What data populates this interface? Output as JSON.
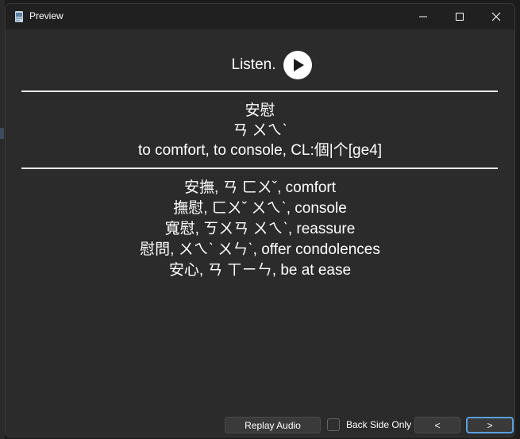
{
  "window": {
    "title": "Preview"
  },
  "listen": {
    "label": "Listen."
  },
  "front": {
    "word": "安慰",
    "zhuyin": "ㄢ ㄨㄟˋ",
    "definition": "to comfort, to console, CL:個|个[ge4]"
  },
  "examples": [
    "安撫, ㄢ ㄈㄨˇ, comfort",
    "撫慰, ㄈㄨˇ ㄨㄟˋ, console",
    "寬慰, ㄎㄨㄢ ㄨㄟˋ, reassure",
    "慰問, ㄨㄟˋ ㄨㄣˋ, offer condolences",
    "安心, ㄢ ㄒㄧㄣ, be at ease"
  ],
  "bottom": {
    "replay_label": "Replay Audio",
    "back_side_only_label": "Back Side Only",
    "back_side_only_checked": false,
    "prev_label": "<",
    "next_label": ">"
  }
}
